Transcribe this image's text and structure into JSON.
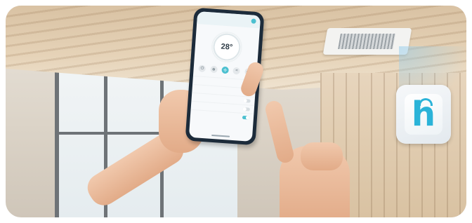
{
  "scene": {
    "description_colors": {
      "accent": "#4cc0d0",
      "app_icon_color": "#2bb3d8",
      "phone_body": "#1c2b3a"
    }
  },
  "phone_app": {
    "title": "",
    "temperature": "28°",
    "mode_icons": [
      "power-icon",
      "mode-icon",
      "fan-icon",
      "swing-icon",
      "timer-icon"
    ],
    "active_mode_index": 2,
    "settings_rows": [
      {
        "label": "",
        "toggle": false
      },
      {
        "label": "",
        "toggle": false
      },
      {
        "label": "",
        "toggle": false
      },
      {
        "label": "",
        "toggle": false
      },
      {
        "label": "",
        "toggle": true
      }
    ]
  },
  "app_icon": {
    "letter": "h"
  }
}
